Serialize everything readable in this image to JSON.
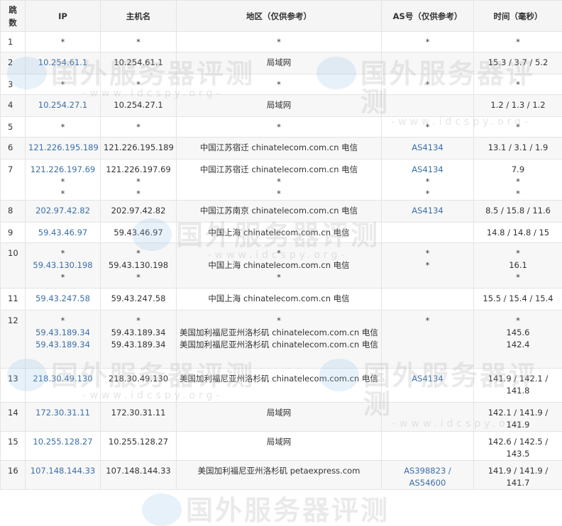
{
  "headers": {
    "hop": "跳数",
    "ip": "IP",
    "host": "主机名",
    "region": "地区（仅供参考）",
    "as": "AS号（仅供参考）",
    "time": "时间（毫秒）"
  },
  "watermark": {
    "cn": "国外服务器评测",
    "en": "-www.idcspy.org-"
  },
  "rows": [
    {
      "hop": "1",
      "ip": [
        "*"
      ],
      "host": [
        "*"
      ],
      "region": [
        "*"
      ],
      "as": [
        "*"
      ],
      "time": [
        "*"
      ]
    },
    {
      "hop": "2",
      "ip": [
        "10.254.61.1"
      ],
      "host": [
        "10.254.61.1"
      ],
      "region": [
        "局域网"
      ],
      "as": [
        ""
      ],
      "time": [
        "15.3 / 3.7 / 5.2"
      ]
    },
    {
      "hop": "3",
      "ip": [
        "*"
      ],
      "host": [
        "*"
      ],
      "region": [
        "*"
      ],
      "as": [
        "*"
      ],
      "time": [
        "*"
      ]
    },
    {
      "hop": "4",
      "ip": [
        "10.254.27.1"
      ],
      "host": [
        "10.254.27.1"
      ],
      "region": [
        "局域网"
      ],
      "as": [
        ""
      ],
      "time": [
        "1.2 / 1.3 / 1.2"
      ]
    },
    {
      "hop": "5",
      "ip": [
        "*"
      ],
      "host": [
        "*"
      ],
      "region": [
        "*"
      ],
      "as": [
        "*"
      ],
      "time": [
        "*"
      ]
    },
    {
      "hop": "6",
      "ip": [
        "121.226.195.189"
      ],
      "host": [
        "121.226.195.189"
      ],
      "region": [
        "中国江苏宿迁 chinatelecom.com.cn 电信"
      ],
      "as": [
        "AS4134"
      ],
      "time": [
        "13.1 / 3.1 / 1.9"
      ]
    },
    {
      "hop": "7",
      "ip": [
        "121.226.197.69",
        "*",
        "*"
      ],
      "host": [
        "121.226.197.69",
        "*",
        "*"
      ],
      "region": [
        "中国江苏宿迁 chinatelecom.com.cn 电信",
        "*",
        "*"
      ],
      "as": [
        "AS4134",
        "*",
        "*"
      ],
      "time": [
        "7.9",
        "*",
        "*"
      ]
    },
    {
      "hop": "8",
      "ip": [
        "202.97.42.82"
      ],
      "host": [
        "202.97.42.82"
      ],
      "region": [
        "中国江苏南京 chinatelecom.com.cn 电信"
      ],
      "as": [
        "AS4134"
      ],
      "time": [
        "8.5 / 15.8 / 11.6"
      ]
    },
    {
      "hop": "9",
      "ip": [
        "59.43.46.97"
      ],
      "host": [
        "59.43.46.97"
      ],
      "region": [
        "中国上海 chinatelecom.com.cn 电信"
      ],
      "as": [
        ""
      ],
      "time": [
        "14.8 / 14.8 / 15"
      ]
    },
    {
      "hop": "10",
      "ip": [
        "*",
        "59.43.130.198",
        "*"
      ],
      "host": [
        "*",
        "59.43.130.198",
        "*"
      ],
      "region": [
        "*",
        "中国上海 chinatelecom.com.cn 电信",
        "*"
      ],
      "as": [
        "*",
        "",
        "*"
      ],
      "time": [
        "*",
        "16.1",
        "*"
      ]
    },
    {
      "hop": "11",
      "ip": [
        "59.43.247.58"
      ],
      "host": [
        "59.43.247.58"
      ],
      "region": [
        "中国上海 chinatelecom.com.cn 电信"
      ],
      "as": [
        ""
      ],
      "time": [
        "15.5 / 15.4 / 15.4"
      ]
    },
    {
      "hop": "12",
      "ip": [
        "*",
        "59.43.189.34",
        "59.43.189.34"
      ],
      "host": [
        "*",
        "59.43.189.34",
        "59.43.189.34"
      ],
      "region": [
        "*",
        "美国加利福尼亚州洛杉矶 chinatelecom.com.cn 电信",
        "美国加利福尼亚州洛杉矶 chinatelecom.com.cn 电信"
      ],
      "as": [
        "*"
      ],
      "time": [
        "*",
        "145.6",
        "142.4"
      ]
    },
    {
      "hop": "13",
      "ip": [
        "218.30.49.130"
      ],
      "host": [
        "218.30.49.130"
      ],
      "region": [
        "美国加利福尼亚州洛杉矶 chinatelecom.com.cn 电信"
      ],
      "as": [
        "AS4134"
      ],
      "time": [
        "141.9 / 142.1 / 141.8"
      ]
    },
    {
      "hop": "14",
      "ip": [
        "172.30.31.11"
      ],
      "host": [
        "172.30.31.11"
      ],
      "region": [
        "局域网"
      ],
      "as": [
        ""
      ],
      "time": [
        "142.1 / 141.9 / 141.9"
      ]
    },
    {
      "hop": "15",
      "ip": [
        "10.255.128.27"
      ],
      "host": [
        "10.255.128.27"
      ],
      "region": [
        "局域网"
      ],
      "as": [
        ""
      ],
      "time": [
        "142.6 / 142.5 / 143.5"
      ]
    },
    {
      "hop": "16",
      "ip": [
        "107.148.144.33"
      ],
      "host": [
        "107.148.144.33"
      ],
      "region": [
        "美国加利福尼亚州洛杉矶 petaexpress.com"
      ],
      "as": [
        "AS398823 / AS54600"
      ],
      "time": [
        "141.9 / 141.9 / 141.7"
      ]
    }
  ]
}
